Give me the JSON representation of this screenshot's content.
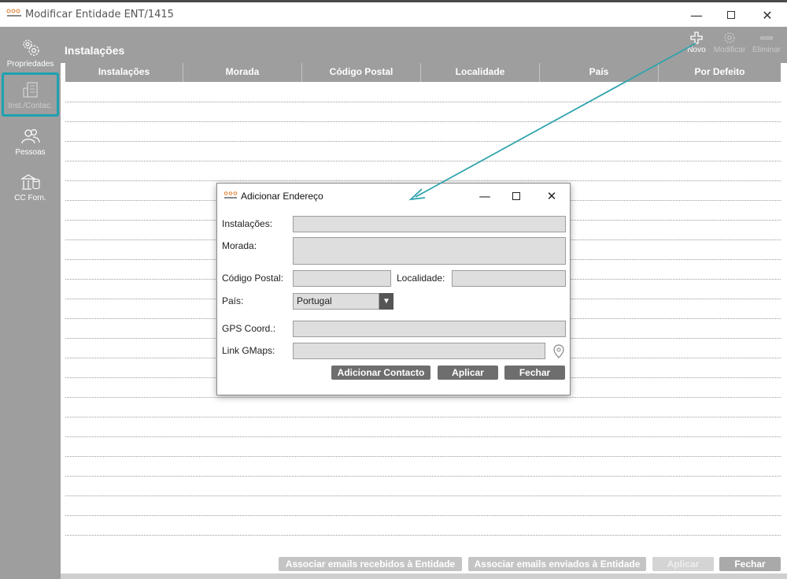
{
  "window": {
    "title": "Modificar Entidade ENT/1415"
  },
  "sidebar": {
    "items": [
      {
        "label": "Propriedades",
        "icon": "gear-cluster-icon"
      },
      {
        "label": "Inst./Contac.",
        "icon": "building-icon"
      },
      {
        "label": "Pessoas",
        "icon": "people-icon"
      },
      {
        "label": "CC Forn.",
        "icon": "bank-coins-icon"
      }
    ]
  },
  "header": {
    "title": "Instalações",
    "tools": [
      {
        "label": "Novo",
        "icon": "plus-icon"
      },
      {
        "label": "Modificar",
        "icon": "gear-icon"
      },
      {
        "label": "Eliminar",
        "icon": "minus-icon"
      }
    ]
  },
  "table": {
    "columns": [
      "Instalações",
      "Morada",
      "Código Postal",
      "Localidade",
      "País",
      "Por Defeito"
    ]
  },
  "footer": {
    "assoc_received": "Associar emails recebidos à Entidade",
    "assoc_sent": "Associar emails enviados à Entidade",
    "apply": "Aplicar",
    "close": "Fechar"
  },
  "dialog": {
    "title": "Adicionar Endereço",
    "labels": {
      "instalacoes": "Instalações:",
      "morada": "Morada:",
      "codigo_postal": "Código Postal:",
      "localidade": "Localidade:",
      "pais": "País:",
      "gps": "GPS Coord.:",
      "gmaps": "Link GMaps:"
    },
    "values": {
      "instalacoes": "",
      "morada": "",
      "codigo_postal": "",
      "localidade": "",
      "pais": "Portugal",
      "gps": "",
      "gmaps": ""
    },
    "buttons": {
      "add_contact": "Adicionar Contacto",
      "apply": "Aplicar",
      "close": "Fechar"
    }
  },
  "colors": {
    "sidebar_bg": "#9e9e9e",
    "accent": "#1da1b0",
    "dialog_button": "#6e6e6e"
  }
}
